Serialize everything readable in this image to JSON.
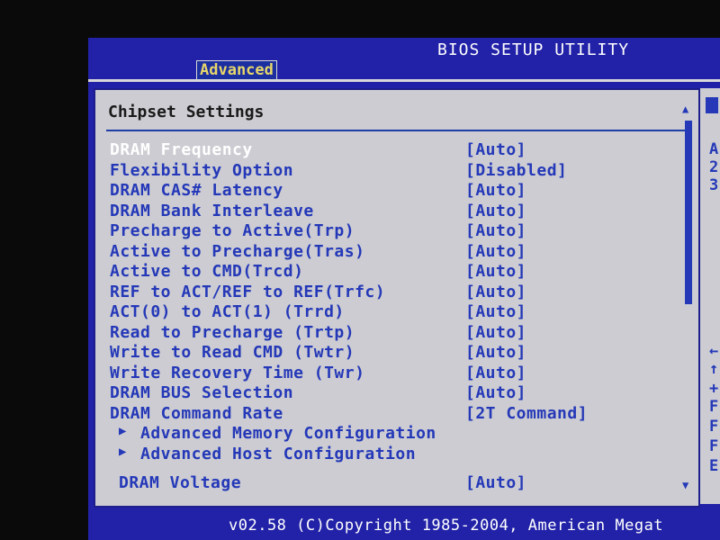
{
  "header": {
    "app_title": "BIOS SETUP UTILITY",
    "active_tab": "Advanced"
  },
  "panel": {
    "title": "Chipset Settings",
    "items": [
      {
        "label": "DRAM Frequency",
        "value": "[Auto]"
      },
      {
        "label": "Flexibility Option",
        "value": "[Disabled]"
      },
      {
        "label": "DRAM CAS# Latency",
        "value": "[Auto]"
      },
      {
        "label": "DRAM Bank Interleave",
        "value": "[Auto]"
      },
      {
        "label": "Precharge to Active(Trp)",
        "value": "[Auto]"
      },
      {
        "label": "Active to Precharge(Tras)",
        "value": "[Auto]"
      },
      {
        "label": "Active to CMD(Trcd)",
        "value": "[Auto]"
      },
      {
        "label": "REF to ACT/REF to REF(Trfc)",
        "value": "[Auto]"
      },
      {
        "label": "ACT(0) to ACT(1) (Trrd)",
        "value": "[Auto]"
      },
      {
        "label": "Read to Precharge (Trtp)",
        "value": "[Auto]"
      },
      {
        "label": "Write to Read CMD (Twtr)",
        "value": "[Auto]"
      },
      {
        "label": "Write Recovery Time (Twr)",
        "value": "[Auto]"
      },
      {
        "label": "DRAM BUS Selection",
        "value": "[Auto]"
      },
      {
        "label": "DRAM Command Rate",
        "value": "[2T Command]"
      }
    ],
    "submenus": [
      {
        "arrow": "▶",
        "label": "Advanced Memory Configuration"
      },
      {
        "arrow": "▶",
        "label": "Advanced Host Configuration"
      }
    ],
    "voltage": {
      "label": "DRAM Voltage",
      "value": "[Auto]"
    }
  },
  "scrollbar": {
    "up_icon": "▲",
    "down_icon": "▼"
  },
  "help_panel": {
    "chars": [
      "A",
      "2",
      "3",
      "←",
      "↑",
      "+",
      "F",
      "F",
      "F",
      "E"
    ]
  },
  "footer": {
    "text": "v02.58 (C)Copyright 1985-2004, American Megat"
  },
  "colors": {
    "background": "#2222a8",
    "panel": "#ccccd2",
    "text_blue": "#2438b8",
    "tab_text": "#e7d76a"
  }
}
